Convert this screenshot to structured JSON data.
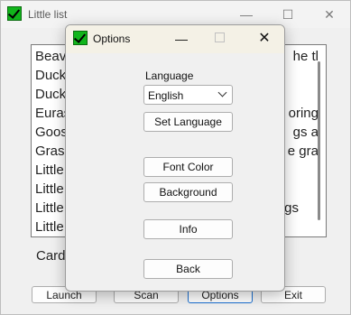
{
  "main_window": {
    "title": "Little list",
    "minimize_glyph": "—",
    "maximize_glyph": "☐",
    "close_glyph": "✕",
    "list_items": [
      "Beave",
      "Duck",
      "Duck",
      "Euras",
      "Goos",
      "Grass",
      "Little",
      "Little",
      "Little",
      "Little"
    ],
    "list_right_fragments": [
      "he tl",
      "",
      "",
      "oring",
      "gs a",
      "e gra",
      "",
      "",
      "gs",
      ""
    ],
    "card_label": "Card",
    "buttons": {
      "launch": "Launch",
      "scan": "Scan",
      "options": "Options",
      "exit": "Exit"
    }
  },
  "options_dialog": {
    "title": "Options",
    "minimize_glyph": "—",
    "close_glyph": "✕",
    "language_label": "Language",
    "language_selected": "English",
    "set_language": "Set Language",
    "font_color": "Font Color",
    "background": "Background",
    "info": "Info",
    "back": "Back"
  },
  "colors": {
    "accent_focus": "#1a6fd0",
    "app_icon_green": "#11b51b"
  },
  "icons": [
    "checkmark-app-icon"
  ]
}
